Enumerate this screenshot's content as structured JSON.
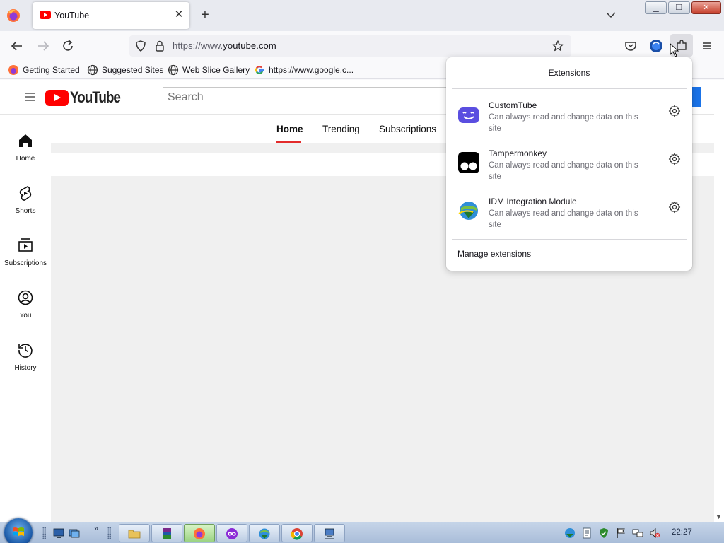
{
  "browser": {
    "tab": {
      "title": "YouTube"
    },
    "url": {
      "scheme": "https://www.",
      "domain": "youtube.com"
    },
    "bookmarks": [
      {
        "label": "Getting Started",
        "icon": "firefox-icon"
      },
      {
        "label": "Suggested Sites",
        "icon": "globe-icon"
      },
      {
        "label": "Web Slice Gallery",
        "icon": "globe-icon"
      },
      {
        "label": "https://www.google.c...",
        "icon": "google-icon"
      }
    ]
  },
  "youtube": {
    "logo_text": "YouTube",
    "search_placeholder": "Search",
    "sidebar": [
      {
        "label": "Home",
        "icon": "home-icon"
      },
      {
        "label": "Shorts",
        "icon": "shorts-icon"
      },
      {
        "label": "Subscriptions",
        "icon": "subscriptions-icon"
      },
      {
        "label": "You",
        "icon": "you-icon"
      },
      {
        "label": "History",
        "icon": "history-icon"
      }
    ],
    "tabs": [
      {
        "label": "Home",
        "active": true
      },
      {
        "label": "Trending",
        "active": false
      },
      {
        "label": "Subscriptions",
        "active": false
      }
    ]
  },
  "extensions_panel": {
    "title": "Extensions",
    "items": [
      {
        "name": "CustomTube",
        "description": "Can always read and change data on this site",
        "icon": "customtube-icon"
      },
      {
        "name": "Tampermonkey",
        "description": "Can always read and change data on this site",
        "icon": "tampermonkey-icon"
      },
      {
        "name": "IDM Integration Module",
        "description": "Can always read and change data on this site",
        "icon": "idm-icon"
      }
    ],
    "manage_label": "Manage extensions"
  },
  "taskbar": {
    "clock": "22:27"
  },
  "colors": {
    "youtube_red": "#ff0000",
    "active_tab_underline": "#e32b2b",
    "customtube_purple": "#5a4ee0"
  }
}
